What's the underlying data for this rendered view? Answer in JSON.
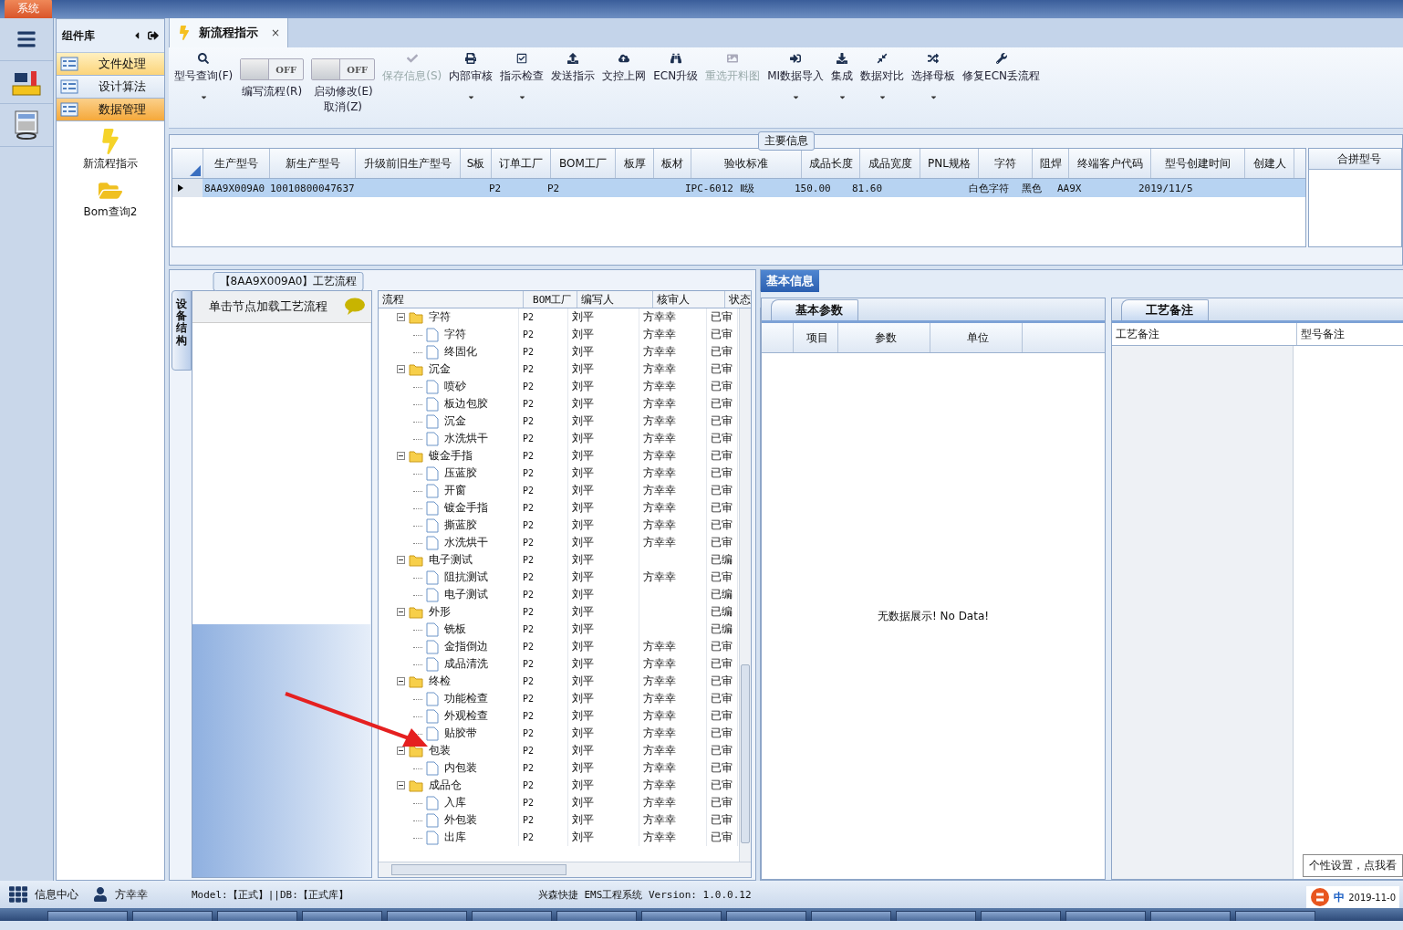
{
  "system_tab": {
    "label": "系统"
  },
  "component_panel": {
    "title": "组件库",
    "items": [
      {
        "label": "文件处理",
        "selected": false,
        "hovered": true
      },
      {
        "label": "设计算法",
        "selected": false,
        "hovered": false
      },
      {
        "label": "数据管理",
        "selected": true,
        "hovered": false
      }
    ],
    "tools": [
      {
        "label": "新流程指示"
      },
      {
        "label": "Bom查询2"
      }
    ]
  },
  "doc_tab": {
    "label": "新流程指示",
    "close": "×"
  },
  "ribbon": [
    {
      "kind": "button",
      "label": "型号查询(F)",
      "disabled": false,
      "dropdown": true
    },
    {
      "kind": "toggle",
      "label": "编写流程(R)",
      "toggle_text": "OFF",
      "on": false
    },
    {
      "kind": "toggle",
      "label": "启动修改(E)",
      "label2": "取消(Z)",
      "toggle_text": "OFF",
      "on": false
    },
    {
      "kind": "button",
      "label": "保存信息(S)",
      "disabled": true,
      "dropdown": false
    },
    {
      "kind": "button",
      "label": "内部审核",
      "disabled": false,
      "dropdown": true
    },
    {
      "kind": "button",
      "label": "指示检查",
      "disabled": false,
      "dropdown": true
    },
    {
      "kind": "button",
      "label": "发送指示",
      "disabled": false,
      "dropdown": false
    },
    {
      "kind": "button",
      "label": "文控上网",
      "disabled": false,
      "dropdown": false
    },
    {
      "kind": "button",
      "label": "ECN升级",
      "disabled": false,
      "dropdown": false
    },
    {
      "kind": "button",
      "label": "重选开料图",
      "disabled": true,
      "dropdown": false
    },
    {
      "kind": "button",
      "label": "MI数据导入",
      "disabled": false,
      "dropdown": true
    },
    {
      "kind": "button",
      "label": "集成",
      "disabled": false,
      "dropdown": true
    },
    {
      "kind": "button",
      "label": "数据对比",
      "disabled": false,
      "dropdown": true
    },
    {
      "kind": "button",
      "label": "选择母板",
      "disabled": false,
      "dropdown": true
    },
    {
      "kind": "button",
      "label": "修复ECN丢流程",
      "disabled": false,
      "dropdown": false
    }
  ],
  "main_info": {
    "legend": "主要信息",
    "columns": [
      "生产型号",
      "新生产型号",
      "升级前旧生产型号",
      "S板",
      "订单工厂",
      "BOM工厂",
      "板厚",
      "板材",
      "验收标准",
      "成品长度",
      "成品宽度",
      "PNL规格",
      "字符",
      "阻焊",
      "终端客户代码",
      "型号创建时间",
      "创建人"
    ],
    "rows": [
      {
        "selected": true,
        "cells": [
          "8AA9X009A0",
          "10010800047637",
          null,
          null,
          "P2",
          "P2",
          null,
          null,
          "IPC-6012 Ⅱ级",
          "150.00",
          "81.60",
          null,
          "白色字符",
          "黑色",
          "AA9X",
          "2019/11/5",
          null
        ]
      }
    ],
    "side_column": "合拼型号"
  },
  "process": {
    "legend": "【8AA9X009A0】工艺流程",
    "side_tab": "设备结构",
    "hint": "单击节点加载工艺流程",
    "columns": [
      "流程",
      "BOM工厂",
      "编写人",
      "核审人",
      "状态"
    ],
    "tree": [
      {
        "name": "字符",
        "bom": "P2",
        "writer": "刘平",
        "reviewer": "方幸幸",
        "status": "已审",
        "expanded": true,
        "children": [
          {
            "name": "字符",
            "bom": "P2",
            "writer": "刘平",
            "reviewer": "方幸幸",
            "status": "已审"
          },
          {
            "name": "终固化",
            "bom": "P2",
            "writer": "刘平",
            "reviewer": "方幸幸",
            "status": "已审"
          }
        ]
      },
      {
        "name": "沉金",
        "bom": "P2",
        "writer": "刘平",
        "reviewer": "方幸幸",
        "status": "已审",
        "expanded": true,
        "children": [
          {
            "name": "喷砂",
            "bom": "P2",
            "writer": "刘平",
            "reviewer": "方幸幸",
            "status": "已审"
          },
          {
            "name": "板边包胶",
            "bom": "P2",
            "writer": "刘平",
            "reviewer": "方幸幸",
            "status": "已审"
          },
          {
            "name": "沉金",
            "bom": "P2",
            "writer": "刘平",
            "reviewer": "方幸幸",
            "status": "已审"
          },
          {
            "name": "水洗烘干",
            "bom": "P2",
            "writer": "刘平",
            "reviewer": "方幸幸",
            "status": "已审"
          }
        ]
      },
      {
        "name": "镀金手指",
        "bom": "P2",
        "writer": "刘平",
        "reviewer": "方幸幸",
        "status": "已审",
        "expanded": true,
        "children": [
          {
            "name": "压蓝胶",
            "bom": "P2",
            "writer": "刘平",
            "reviewer": "方幸幸",
            "status": "已审"
          },
          {
            "name": "开窗",
            "bom": "P2",
            "writer": "刘平",
            "reviewer": "方幸幸",
            "status": "已审"
          },
          {
            "name": "镀金手指",
            "bom": "P2",
            "writer": "刘平",
            "reviewer": "方幸幸",
            "status": "已审"
          },
          {
            "name": "撕蓝胶",
            "bom": "P2",
            "writer": "刘平",
            "reviewer": "方幸幸",
            "status": "已审"
          },
          {
            "name": "水洗烘干",
            "bom": "P2",
            "writer": "刘平",
            "reviewer": "方幸幸",
            "status": "已审"
          }
        ]
      },
      {
        "name": "电子测试",
        "bom": "P2",
        "writer": "刘平",
        "status": "已编",
        "expanded": true,
        "children": [
          {
            "name": "阻抗测试",
            "bom": "P2",
            "writer": "刘平",
            "reviewer": "方幸幸",
            "status": "已审"
          },
          {
            "name": "电子测试",
            "bom": "P2",
            "writer": "刘平",
            "status": "已编"
          }
        ]
      },
      {
        "name": "外形",
        "bom": "P2",
        "writer": "刘平",
        "status": "已编",
        "expanded": true,
        "children": [
          {
            "name": "铣板",
            "bom": "P2",
            "writer": "刘平",
            "status": "已编"
          },
          {
            "name": "金指倒边",
            "bom": "P2",
            "writer": "刘平",
            "reviewer": "方幸幸",
            "status": "已审"
          },
          {
            "name": "成品清洗",
            "bom": "P2",
            "writer": "刘平",
            "reviewer": "方幸幸",
            "status": "已审"
          }
        ]
      },
      {
        "name": "终检",
        "bom": "P2",
        "writer": "刘平",
        "reviewer": "方幸幸",
        "status": "已审",
        "expanded": true,
        "children": [
          {
            "name": "功能检查",
            "bom": "P2",
            "writer": "刘平",
            "reviewer": "方幸幸",
            "status": "已审"
          },
          {
            "name": "外观检查",
            "bom": "P2",
            "writer": "刘平",
            "reviewer": "方幸幸",
            "status": "已审"
          },
          {
            "name": "贴胶带",
            "bom": "P2",
            "writer": "刘平",
            "reviewer": "方幸幸",
            "status": "已审"
          }
        ]
      },
      {
        "name": "包装",
        "bom": "P2",
        "writer": "刘平",
        "reviewer": "方幸幸",
        "status": "已审",
        "expanded": true,
        "children": [
          {
            "name": "内包装",
            "bom": "P2",
            "writer": "刘平",
            "reviewer": "方幸幸",
            "status": "已审"
          }
        ]
      },
      {
        "name": "成品仓",
        "bom": "P2",
        "writer": "刘平",
        "reviewer": "方幸幸",
        "status": "已审",
        "expanded": true,
        "children": [
          {
            "name": "入库",
            "bom": "P2",
            "writer": "刘平",
            "reviewer": "方幸幸",
            "status": "已审"
          },
          {
            "name": "外包装",
            "bom": "P2",
            "writer": "刘平",
            "reviewer": "方幸幸",
            "status": "已审"
          },
          {
            "name": "出库",
            "bom": "P2",
            "writer": "刘平",
            "reviewer": "方幸幸",
            "status": "已审"
          }
        ]
      }
    ]
  },
  "basic_info": {
    "tab": "基本信息",
    "params_tab": "基本参数",
    "params_columns": [
      "项目",
      "参数",
      "单位"
    ],
    "empty_text": "无数据展示! No Data!",
    "notes_tab": "工艺备注",
    "notes_columns": [
      "工艺备注",
      "型号备注"
    ]
  },
  "status_bar": {
    "info_center": "信息中心",
    "user": "方幸幸",
    "model": "Model:【正式】||DB:【正式库】",
    "version": "兴森快捷 EMS工程系统 Version: 1.0.0.12"
  },
  "tray": {
    "tooltip": "个性设置，点我看",
    "ime": "中",
    "clock": "2019-11-0"
  }
}
